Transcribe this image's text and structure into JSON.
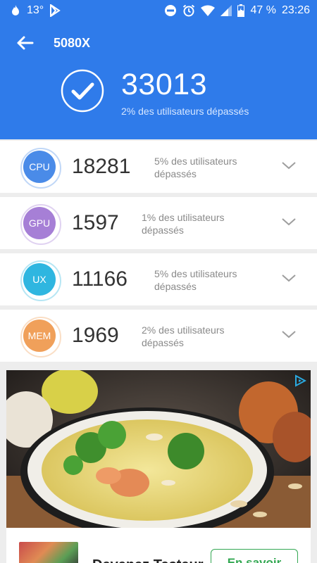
{
  "status_bar": {
    "temperature": "13°",
    "battery": "47 %",
    "time": "23:26"
  },
  "header": {
    "title": "5080X",
    "total_score": "33013",
    "total_subtitle": "2% des utilisateurs dépassés",
    "color": "#2f7bea"
  },
  "rows": [
    {
      "label": "CPU",
      "score": "18281",
      "desc": "5% des utilisateurs dépassés",
      "color": "#4a8be8"
    },
    {
      "label": "GPU",
      "score": "1597",
      "desc": "1% des utilisateurs dépassés",
      "color": "#a67fd6"
    },
    {
      "label": "UX",
      "score": "11166",
      "desc": "5% des utilisateurs dépassés",
      "color": "#2fb6e0"
    },
    {
      "label": "MEM",
      "score": "1969",
      "desc": "2% des utilisateurs dépassés",
      "color": "#f0a05a"
    }
  ],
  "ad": {
    "title": "Devenez Testeur",
    "cta": "En savoir"
  }
}
